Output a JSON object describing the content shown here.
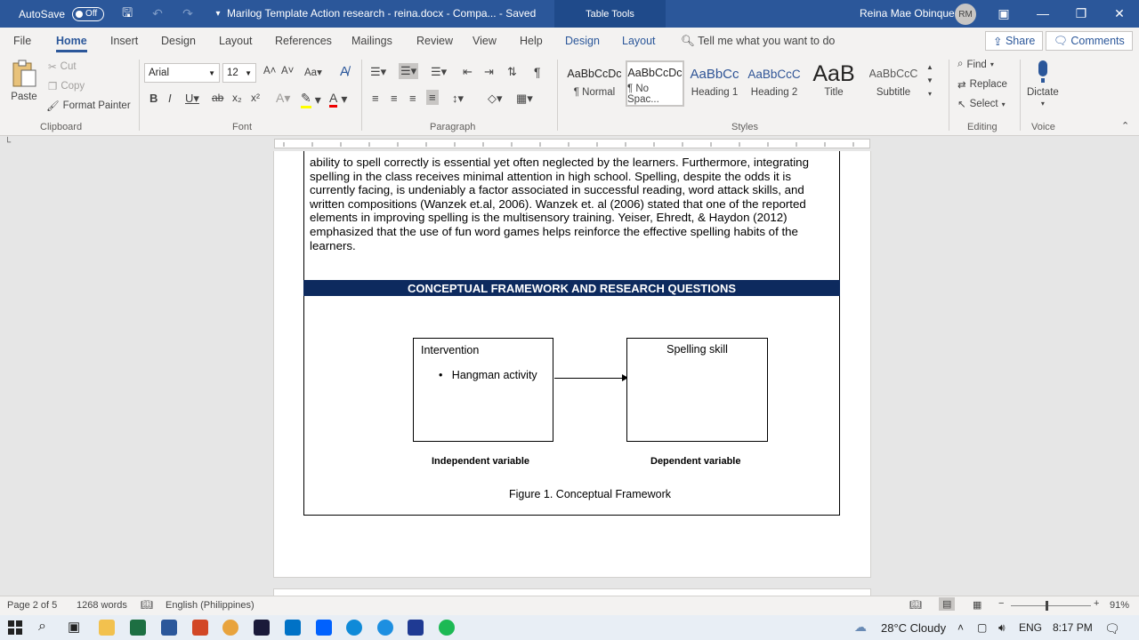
{
  "titlebar": {
    "autosave_label": "AutoSave",
    "autosave_state": "Off",
    "document_title": "Marilog Template Action research - reina.docx  -  Compa...  -  Saved",
    "context_tab": "Table Tools",
    "user_name": "Reina Mae Obinque",
    "user_initials": "RM"
  },
  "tabs": {
    "file": "File",
    "home": "Home",
    "insert": "Insert",
    "design": "Design",
    "layout": "Layout",
    "references": "References",
    "mailings": "Mailings",
    "review": "Review",
    "view": "View",
    "help": "Help",
    "ctx_design": "Design",
    "ctx_layout": "Layout",
    "tell_me": "Tell me what you want to do",
    "share": "Share",
    "comments": "Comments"
  },
  "clipboard": {
    "paste": "Paste",
    "cut": "Cut",
    "copy": "Copy",
    "format_painter": "Format Painter",
    "label": "Clipboard"
  },
  "font": {
    "family": "Arial",
    "size": "12",
    "label": "Font"
  },
  "paragraph": {
    "label": "Paragraph"
  },
  "styles": {
    "label": "Styles",
    "items": [
      {
        "preview": "AaBbCcDc",
        "name": "¶ Normal"
      },
      {
        "preview": "AaBbCcDc",
        "name": "¶ No Spac..."
      },
      {
        "preview": "AaBbCc",
        "name": "Heading 1"
      },
      {
        "preview": "AaBbCcC",
        "name": "Heading 2"
      },
      {
        "preview": "AaB",
        "name": "Title"
      },
      {
        "preview": "AaBbCcC",
        "name": "Subtitle"
      }
    ]
  },
  "editing": {
    "find": "Find",
    "replace": "Replace",
    "select": "Select",
    "label": "Editing"
  },
  "voice": {
    "dictate": "Dictate",
    "label": "Voice"
  },
  "document": {
    "para_lines": [
      "ability to spell correctly is essential yet often neglected by the learners. Furthermore, integrating",
      "spelling in the class receives minimal attention in high school. Spelling, despite the odds it is",
      "currently facing, is undeniably a factor associated in successful reading, word attack skills, and",
      "written compositions (Wanzek et.al, 2006). Wanzek et. al (2006) stated that one of the reported",
      "elements in improving spelling is the multisensory training. Yeiser, Ehredt, & Haydon (2012)",
      "emphasized that the use of fun word games helps reinforce the effective spelling habits of the",
      "learners."
    ],
    "section_header": "CONCEPTUAL FRAMEWORK AND RESEARCH QUESTIONS",
    "box_left_title": "Intervention",
    "box_left_bullet": "Hangman activity",
    "box_right_title": "Spelling skill",
    "independent_label": "Independent variable",
    "dependent_label": "Dependent variable",
    "figure_caption": "Figure 1. Conceptual Framework"
  },
  "status": {
    "page": "Page 2 of 5",
    "words": "1268 words",
    "language": "English (Philippines)",
    "zoom": "91%"
  },
  "taskbar": {
    "weather": "28°C  Cloudy",
    "lang": "ENG",
    "time": "8:17 PM"
  }
}
